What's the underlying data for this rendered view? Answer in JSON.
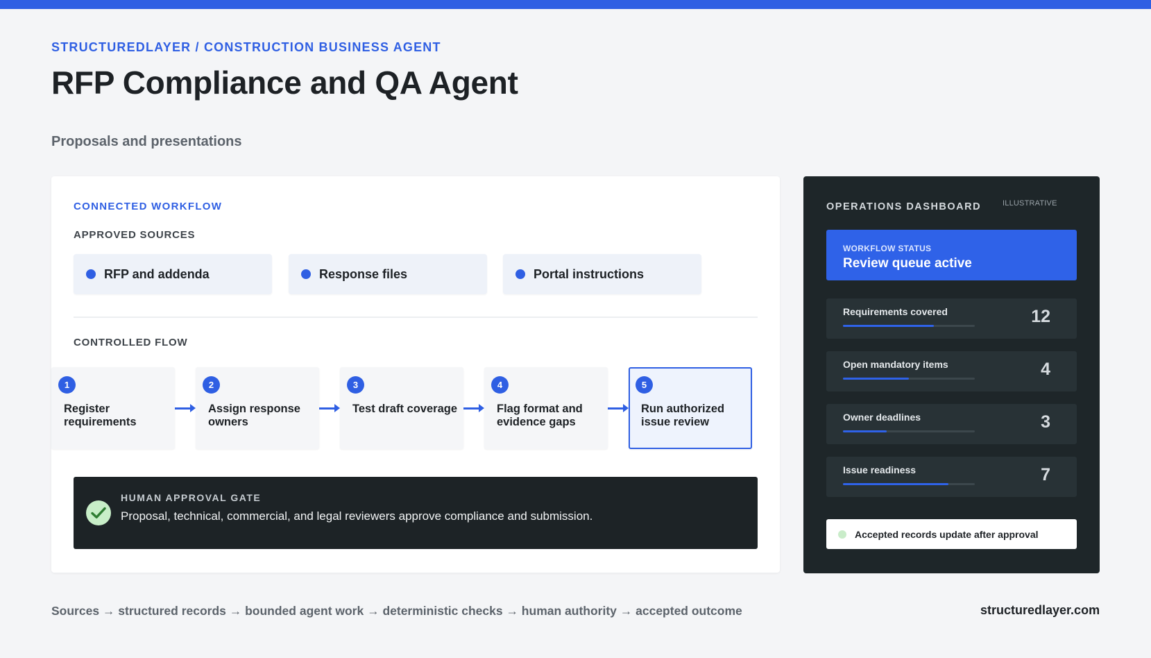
{
  "header": {
    "breadcrumb": "STRUCTUREDLAYER / CONSTRUCTION BUSINESS AGENT",
    "title": "RFP Compliance and QA Agent",
    "subtitle": "Proposals and presentations"
  },
  "workflow": {
    "section_label": "CONNECTED WORKFLOW",
    "sources_label": "APPROVED SOURCES",
    "sources": [
      {
        "label": "RFP and addenda"
      },
      {
        "label": "Response files"
      },
      {
        "label": "Portal instructions"
      }
    ],
    "flow_label": "CONTROLLED FLOW",
    "steps": [
      {
        "number": "1",
        "label": "Register requirements"
      },
      {
        "number": "2",
        "label": "Assign response owners"
      },
      {
        "number": "3",
        "label": "Test draft coverage"
      },
      {
        "number": "4",
        "label": "Flag format and evidence gaps"
      },
      {
        "number": "5",
        "label": "Run authorized issue review"
      }
    ],
    "gate": {
      "title": "HUMAN APPROVAL GATE",
      "text": "Proposal, technical, commercial, and legal reviewers approve compliance and submission."
    }
  },
  "dashboard": {
    "title": "OPERATIONS DASHBOARD",
    "tag": "ILLUSTRATIVE",
    "status": {
      "label": "WORKFLOW STATUS",
      "value": "Review queue active"
    },
    "metrics": [
      {
        "label": "Requirements covered",
        "value": "12",
        "progress": 0.69
      },
      {
        "label": "Open mandatory items",
        "value": "4",
        "progress": 0.5
      },
      {
        "label": "Owner deadlines",
        "value": "3",
        "progress": 0.33
      },
      {
        "label": "Issue readiness",
        "value": "7",
        "progress": 0.8
      }
    ],
    "footer": "Accepted records update after approval"
  },
  "footer": {
    "flow": "Sources → structured records → bounded agent work → deterministic checks → human authority → accepted outcome",
    "site": "structuredlayer.com"
  },
  "colors": {
    "accent": "#2f5fe3",
    "dark_panel": "#1e2629",
    "approval_green": "#c8eec8"
  }
}
